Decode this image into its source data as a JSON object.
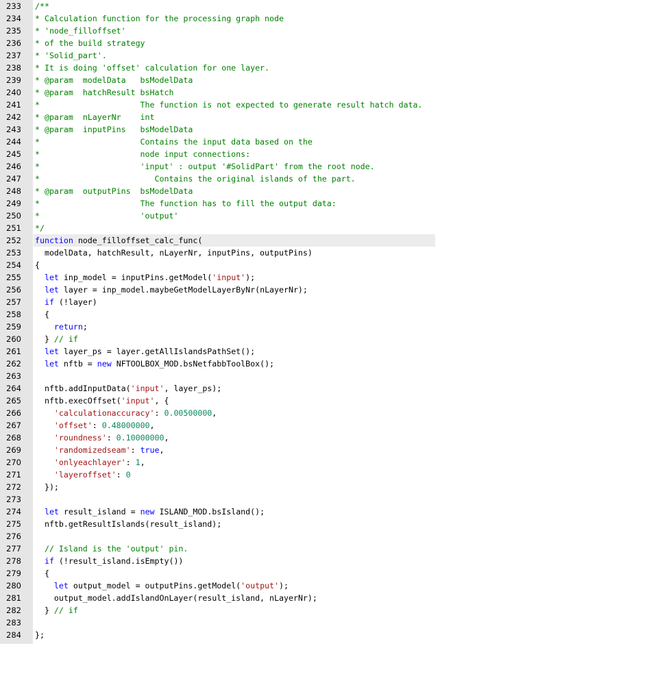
{
  "editor": {
    "highlighted_line": 252,
    "lines": [
      {
        "n": "233",
        "tokens": [
          {
            "k": "cmt",
            "t": "/**"
          }
        ]
      },
      {
        "n": "234",
        "tokens": [
          {
            "k": "cmt",
            "t": "* Calculation function for the processing graph node"
          }
        ]
      },
      {
        "n": "235",
        "tokens": [
          {
            "k": "cmt",
            "t": "* 'node_filloffset'"
          }
        ]
      },
      {
        "n": "236",
        "tokens": [
          {
            "k": "cmt",
            "t": "* of the build strategy"
          }
        ]
      },
      {
        "n": "237",
        "tokens": [
          {
            "k": "cmt",
            "t": "* 'Solid_part'."
          }
        ]
      },
      {
        "n": "238",
        "tokens": [
          {
            "k": "cmt",
            "t": "* It is doing 'offset' calculation for one layer."
          }
        ]
      },
      {
        "n": "239",
        "tokens": [
          {
            "k": "cmt",
            "t": "* @param  modelData   bsModelData"
          }
        ]
      },
      {
        "n": "240",
        "tokens": [
          {
            "k": "cmt",
            "t": "* @param  hatchResult bsHatch"
          }
        ]
      },
      {
        "n": "241",
        "tokens": [
          {
            "k": "cmt",
            "t": "*                     The function is not expected to generate result hatch data."
          }
        ]
      },
      {
        "n": "242",
        "tokens": [
          {
            "k": "cmt",
            "t": "* @param  nLayerNr    int"
          }
        ]
      },
      {
        "n": "243",
        "tokens": [
          {
            "k": "cmt",
            "t": "* @param  inputPins   bsModelData"
          }
        ]
      },
      {
        "n": "244",
        "tokens": [
          {
            "k": "cmt",
            "t": "*                     Contains the input data based on the"
          }
        ]
      },
      {
        "n": "245",
        "tokens": [
          {
            "k": "cmt",
            "t": "*                     node input connections:"
          }
        ]
      },
      {
        "n": "246",
        "tokens": [
          {
            "k": "cmt",
            "t": "*                     'input' : output '#SolidPart' from the root node."
          }
        ]
      },
      {
        "n": "247",
        "tokens": [
          {
            "k": "cmt",
            "t": "*                        Contains the original islands of the part."
          }
        ]
      },
      {
        "n": "248",
        "tokens": [
          {
            "k": "cmt",
            "t": "* @param  outputPins  bsModelData"
          }
        ]
      },
      {
        "n": "249",
        "tokens": [
          {
            "k": "cmt",
            "t": "*                     The function has to fill the output data:"
          }
        ]
      },
      {
        "n": "250",
        "tokens": [
          {
            "k": "cmt",
            "t": "*                     'output'"
          }
        ]
      },
      {
        "n": "251",
        "tokens": [
          {
            "k": "cmt",
            "t": "*/"
          }
        ]
      },
      {
        "n": "252",
        "tokens": [
          {
            "k": "kw",
            "t": "function"
          },
          {
            "k": "plain",
            "t": " node_filloffset_calc_func("
          }
        ]
      },
      {
        "n": "253",
        "tokens": [
          {
            "k": "plain",
            "t": "  modelData, hatchResult, nLayerNr, inputPins, outputPins)"
          }
        ]
      },
      {
        "n": "254",
        "tokens": [
          {
            "k": "plain",
            "t": "{"
          }
        ]
      },
      {
        "n": "255",
        "tokens": [
          {
            "k": "plain",
            "t": "  "
          },
          {
            "k": "kw",
            "t": "let"
          },
          {
            "k": "plain",
            "t": " inp_model = inputPins.getModel("
          },
          {
            "k": "str",
            "t": "'input'"
          },
          {
            "k": "plain",
            "t": ");"
          }
        ]
      },
      {
        "n": "256",
        "tokens": [
          {
            "k": "plain",
            "t": "  "
          },
          {
            "k": "kw",
            "t": "let"
          },
          {
            "k": "plain",
            "t": " layer = inp_model.maybeGetModelLayerByNr(nLayerNr);"
          }
        ]
      },
      {
        "n": "257",
        "tokens": [
          {
            "k": "plain",
            "t": "  "
          },
          {
            "k": "kw",
            "t": "if"
          },
          {
            "k": "plain",
            "t": " (!layer)"
          }
        ]
      },
      {
        "n": "258",
        "tokens": [
          {
            "k": "plain",
            "t": "  {"
          }
        ]
      },
      {
        "n": "259",
        "tokens": [
          {
            "k": "plain",
            "t": "    "
          },
          {
            "k": "kw",
            "t": "return"
          },
          {
            "k": "plain",
            "t": ";"
          }
        ]
      },
      {
        "n": "260",
        "tokens": [
          {
            "k": "plain",
            "t": "  } "
          },
          {
            "k": "cmt",
            "t": "// if"
          }
        ]
      },
      {
        "n": "261",
        "tokens": [
          {
            "k": "plain",
            "t": "  "
          },
          {
            "k": "kw",
            "t": "let"
          },
          {
            "k": "plain",
            "t": " layer_ps = layer.getAllIslandsPathSet();"
          }
        ]
      },
      {
        "n": "262",
        "tokens": [
          {
            "k": "plain",
            "t": "  "
          },
          {
            "k": "kw",
            "t": "let"
          },
          {
            "k": "plain",
            "t": " nftb = "
          },
          {
            "k": "kw",
            "t": "new"
          },
          {
            "k": "plain",
            "t": " NFTOOLBOX_MOD.bsNetfabbToolBox();"
          }
        ]
      },
      {
        "n": "263",
        "tokens": []
      },
      {
        "n": "264",
        "tokens": [
          {
            "k": "plain",
            "t": "  nftb.addInputData("
          },
          {
            "k": "str",
            "t": "'input'"
          },
          {
            "k": "plain",
            "t": ", layer_ps);"
          }
        ]
      },
      {
        "n": "265",
        "tokens": [
          {
            "k": "plain",
            "t": "  nftb.execOffset("
          },
          {
            "k": "str",
            "t": "'input'"
          },
          {
            "k": "plain",
            "t": ", {"
          }
        ]
      },
      {
        "n": "266",
        "tokens": [
          {
            "k": "plain",
            "t": "    "
          },
          {
            "k": "str",
            "t": "'calculationaccuracy'"
          },
          {
            "k": "plain",
            "t": ": "
          },
          {
            "k": "num",
            "t": "0.00500000"
          },
          {
            "k": "plain",
            "t": ","
          }
        ]
      },
      {
        "n": "267",
        "tokens": [
          {
            "k": "plain",
            "t": "    "
          },
          {
            "k": "str",
            "t": "'offset'"
          },
          {
            "k": "plain",
            "t": ": "
          },
          {
            "k": "num",
            "t": "0.48000000"
          },
          {
            "k": "plain",
            "t": ","
          }
        ]
      },
      {
        "n": "268",
        "tokens": [
          {
            "k": "plain",
            "t": "    "
          },
          {
            "k": "str",
            "t": "'roundness'"
          },
          {
            "k": "plain",
            "t": ": "
          },
          {
            "k": "num",
            "t": "0.10000000"
          },
          {
            "k": "plain",
            "t": ","
          }
        ]
      },
      {
        "n": "269",
        "tokens": [
          {
            "k": "plain",
            "t": "    "
          },
          {
            "k": "str",
            "t": "'randomizedseam'"
          },
          {
            "k": "plain",
            "t": ": "
          },
          {
            "k": "kw",
            "t": "true"
          },
          {
            "k": "plain",
            "t": ","
          }
        ]
      },
      {
        "n": "270",
        "tokens": [
          {
            "k": "plain",
            "t": "    "
          },
          {
            "k": "str",
            "t": "'onlyeachlayer'"
          },
          {
            "k": "plain",
            "t": ": "
          },
          {
            "k": "num",
            "t": "1"
          },
          {
            "k": "plain",
            "t": ","
          }
        ]
      },
      {
        "n": "271",
        "tokens": [
          {
            "k": "plain",
            "t": "    "
          },
          {
            "k": "str",
            "t": "'layeroffset'"
          },
          {
            "k": "plain",
            "t": ": "
          },
          {
            "k": "num",
            "t": "0"
          }
        ]
      },
      {
        "n": "272",
        "tokens": [
          {
            "k": "plain",
            "t": "  });"
          }
        ]
      },
      {
        "n": "273",
        "tokens": []
      },
      {
        "n": "274",
        "tokens": [
          {
            "k": "plain",
            "t": "  "
          },
          {
            "k": "kw",
            "t": "let"
          },
          {
            "k": "plain",
            "t": " result_island = "
          },
          {
            "k": "kw",
            "t": "new"
          },
          {
            "k": "plain",
            "t": " ISLAND_MOD.bsIsland();"
          }
        ]
      },
      {
        "n": "275",
        "tokens": [
          {
            "k": "plain",
            "t": "  nftb.getResultIslands(result_island);"
          }
        ]
      },
      {
        "n": "276",
        "tokens": []
      },
      {
        "n": "277",
        "tokens": [
          {
            "k": "plain",
            "t": "  "
          },
          {
            "k": "cmt",
            "t": "// Island is the 'output' pin."
          }
        ]
      },
      {
        "n": "278",
        "tokens": [
          {
            "k": "plain",
            "t": "  "
          },
          {
            "k": "kw",
            "t": "if"
          },
          {
            "k": "plain",
            "t": " (!result_island.isEmpty())"
          }
        ]
      },
      {
        "n": "279",
        "tokens": [
          {
            "k": "plain",
            "t": "  {"
          }
        ]
      },
      {
        "n": "280",
        "tokens": [
          {
            "k": "plain",
            "t": "    "
          },
          {
            "k": "kw",
            "t": "let"
          },
          {
            "k": "plain",
            "t": " output_model = outputPins.getModel("
          },
          {
            "k": "str",
            "t": "'output'"
          },
          {
            "k": "plain",
            "t": ");"
          }
        ]
      },
      {
        "n": "281",
        "tokens": [
          {
            "k": "plain",
            "t": "    output_model.addIslandOnLayer(result_island, nLayerNr);"
          }
        ]
      },
      {
        "n": "282",
        "tokens": [
          {
            "k": "plain",
            "t": "  } "
          },
          {
            "k": "cmt",
            "t": "// if"
          }
        ]
      },
      {
        "n": "283",
        "tokens": []
      },
      {
        "n": "284",
        "tokens": [
          {
            "k": "plain",
            "t": "};"
          }
        ]
      }
    ]
  }
}
